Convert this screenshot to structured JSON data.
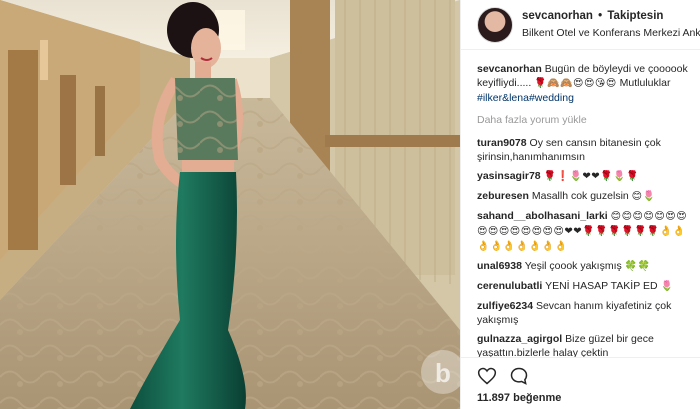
{
  "photo": {
    "watermark": "b"
  },
  "header": {
    "username": "sevcanorhan",
    "separator": "•",
    "follow_status": "Takiptesin",
    "location": "Bilkent Otel ve Konferans Merkezi Ankara"
  },
  "caption": {
    "username": "sevcanorhan",
    "text": "Bugün de böyleydi ve çoooook keyifliydi.....",
    "emojis": "🌹🙈🙈😍😍😘😍",
    "text2": "Mutluluklar",
    "tag1": "#ilker&lena",
    "tag2": "#wedding"
  },
  "load_more": "Daha fazla yorum yükle",
  "comments": [
    {
      "username": "turan9078",
      "text": "Oy sen cansın bitanesin çok şirinsin,hanımhanımsın",
      "emojis": ""
    },
    {
      "username": "yasinsagir78",
      "text": "",
      "emojis": "🌹❗🌷❤❤🌹🌷🌹"
    },
    {
      "username": "zeburesen",
      "text": "Masallh cok guzelsin",
      "emojis": "😊🌷"
    },
    {
      "username": "sahand__abolhasani_larki",
      "text": "",
      "emojis": "😊😊😊😊😊😍😍😍😍😍😍😍😍😍😍❤❤🌹🌹🌹🌹🌹🌹👌👌👌👌👌👌👌👌👌"
    },
    {
      "username": "unal6938",
      "text": "Yeşil çoook yakışmış",
      "emojis": "🍀🍀"
    },
    {
      "username": "cerenulubatli",
      "text": "YENİ HASAP TAKİP ED",
      "emojis": "🌷"
    },
    {
      "username": "zulfiye6234",
      "text": "Sevcan hanım kiyafetiniz çok yakışmış",
      "emojis": ""
    },
    {
      "username": "gulnazza_agirgol",
      "text": "Bize güzel bir gece yaşattın.bizlerle halay çektin",
      "emojis": ""
    }
  ],
  "footer": {
    "like_icon": "heart-outline-icon",
    "comment_icon": "speech-bubble-icon",
    "likes": "11.897 beğenme"
  }
}
